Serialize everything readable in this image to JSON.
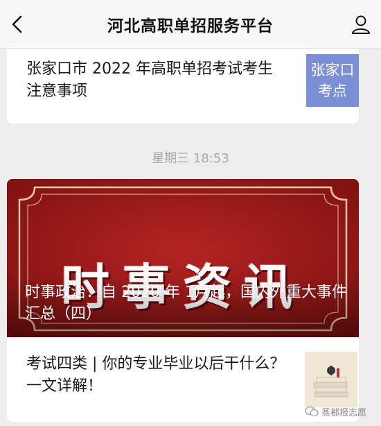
{
  "header": {
    "title": "河北高职单招服务平台",
    "back_icon": "chevron-left-icon",
    "profile_icon": "user-icon"
  },
  "card1": {
    "title": "张家口市 2022 年高职单招考试考生注意事项",
    "thumb_label_line1": "张家口",
    "thumb_label_line2": "考点"
  },
  "timestamp": "星期三 18:53",
  "card2": {
    "banner_text": "时事资讯",
    "article_title": "时事政治：自 2020 年 1月起，国内外重大事件汇总（四）",
    "sub_article_title": "考试四类 | 你的专业毕业以后干什么？一文详解！"
  },
  "watermark": "蒸都报志愿",
  "colors": {
    "banner_red": "#9b1b1a",
    "thumb_blue": "#7a8fd6"
  }
}
